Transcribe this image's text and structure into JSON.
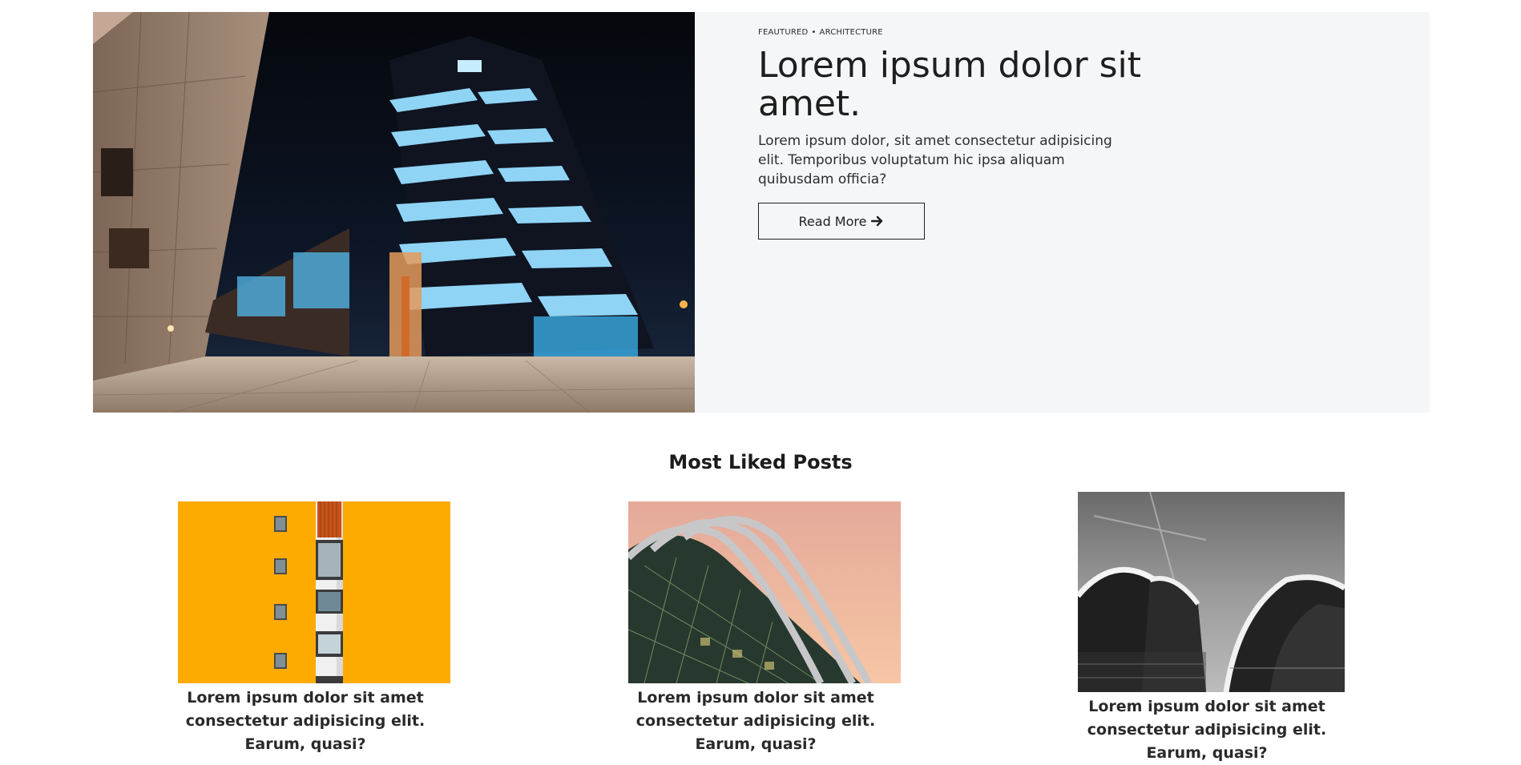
{
  "featured": {
    "category": "FEAUTURED",
    "separator": "•",
    "tag": "ARCHITECTURE",
    "title": "Lorem ipsum dolor sit amet.",
    "description": "Lorem ipsum dolor, sit amet consectetur adipisicing elit. Temporibus voluptatum hic ipsa aliquam quibusdam officia?",
    "button_label": "Read More",
    "button_icon": "arrow-right-icon",
    "image": "night-office-tower-photo"
  },
  "most_liked": {
    "heading": "Most Liked Posts",
    "posts": [
      {
        "title": "Lorem ipsum dolor sit amet consectetur adipisicing elit. Earum, quasi?",
        "image": "yellow-building-facade-photo"
      },
      {
        "title": "Lorem ipsum dolor sit amet consectetur adipisicing elit. Earum, quasi?",
        "image": "glass-dome-arches-photo"
      },
      {
        "title": "Lorem ipsum dolor sit amet consectetur adipisicing elit. Earum, quasi?",
        "image": "opera-house-bw-photo"
      }
    ]
  },
  "colors": {
    "hero_bg": "#f5f6f8",
    "accent_yellow": "#fdab00",
    "text": "#1f1f1f"
  }
}
